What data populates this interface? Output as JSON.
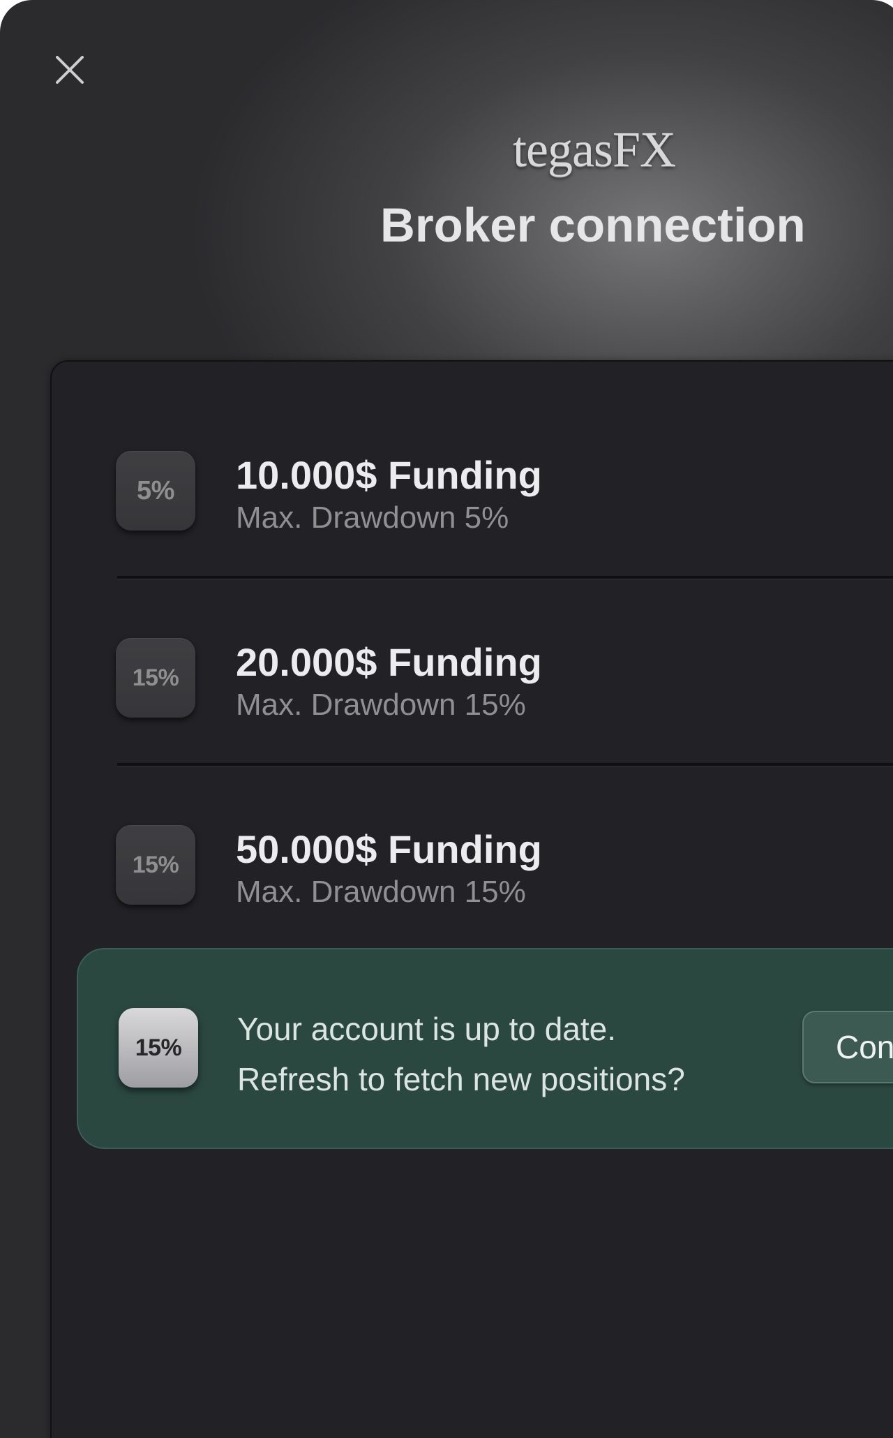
{
  "header": {
    "brand": "tegasFX",
    "title": "Broker connection",
    "close_icon": "close-icon"
  },
  "plans": [
    {
      "badge": "5%",
      "title": "10.000$ Funding",
      "subtitle": "Max. Drawdown 5%"
    },
    {
      "badge": "15%",
      "title": "20.000$ Funding",
      "subtitle": "Max. Drawdown 15%"
    },
    {
      "badge": "15%",
      "title": "50.000$ Funding",
      "subtitle": "Max. Drawdown 15%"
    }
  ],
  "notice": {
    "badge": "15%",
    "line1": "Your account is up to date.",
    "line2": "Refresh to fetch new positions?",
    "button_label": "Con"
  },
  "colors": {
    "background": "#2b2b2e",
    "panel": "#222226",
    "notice": "#2b4840",
    "notice_button": "#3c5a51"
  }
}
